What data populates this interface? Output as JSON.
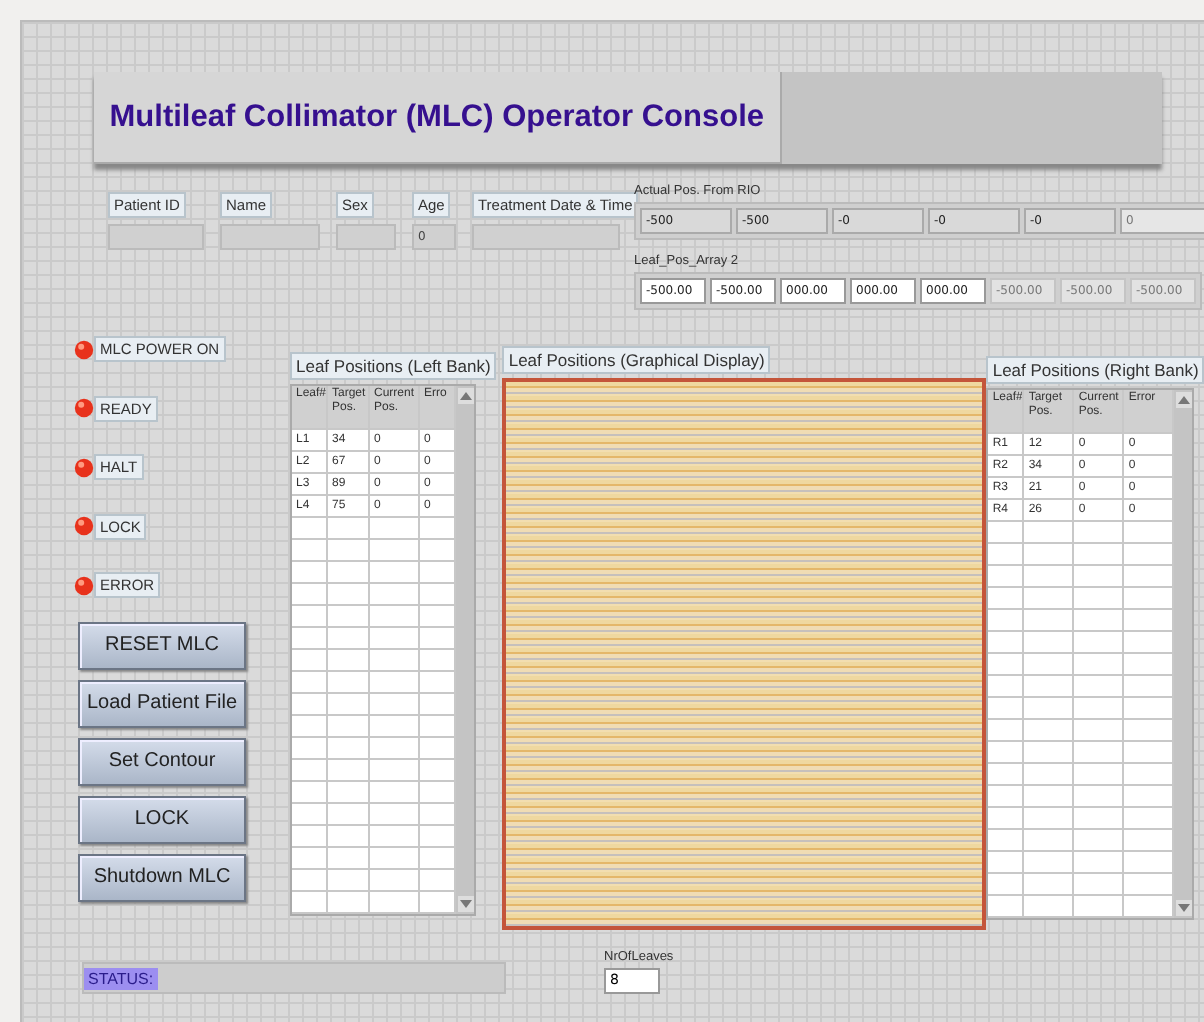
{
  "title": "Multileaf Collimator (MLC) Operator Console",
  "patient_fields": [
    {
      "label": "Patient ID"
    },
    {
      "label": "Name"
    },
    {
      "label": "Sex"
    },
    {
      "label": "Age",
      "value": "0"
    },
    {
      "label": "Treatment Date & Time"
    }
  ],
  "actual_pos": {
    "label": "Actual Pos. From RIO",
    "values": [
      {
        "value": "-500",
        "disabled": false
      },
      {
        "value": "-500",
        "disabled": false
      },
      {
        "value": "-0",
        "disabled": false
      },
      {
        "value": "-0",
        "disabled": false
      },
      {
        "value": "-0",
        "disabled": false
      },
      {
        "value": "0",
        "disabled": true
      }
    ]
  },
  "leaf_pos_array": {
    "label": "Leaf_Pos_Array 2",
    "values": [
      {
        "value": "-500.00",
        "disabled": false
      },
      {
        "value": "-500.00",
        "disabled": false
      },
      {
        "value": "000.00",
        "disabled": false
      },
      {
        "value": "000.00",
        "disabled": false
      },
      {
        "value": "000.00",
        "disabled": false
      },
      {
        "value": "-500.00",
        "disabled": true
      },
      {
        "value": "-500.00",
        "disabled": true
      },
      {
        "value": "-500.00",
        "disabled": true
      }
    ]
  },
  "indicators": [
    {
      "label": "MLC POWER ON",
      "on": true
    },
    {
      "label": "READY",
      "on": true
    },
    {
      "label": "HALT",
      "on": true
    },
    {
      "label": "LOCK",
      "on": true
    },
    {
      "label": "ERROR",
      "on": true
    }
  ],
  "buttons": [
    "RESET MLC",
    "Load Patient File",
    "Set Contour",
    "LOCK",
    "Shutdown MLC"
  ],
  "left_table": {
    "title": "Leaf Positions (Left Bank)",
    "columns": [
      "Leaf#",
      "Target Pos.",
      "Current Pos.",
      "Erro"
    ],
    "rows": [
      [
        "L1",
        "34",
        "0",
        "0"
      ],
      [
        "L2",
        "67",
        "0",
        "0"
      ],
      [
        "L3",
        "89",
        "0",
        "0"
      ],
      [
        "L4",
        "75",
        "0",
        "0"
      ]
    ]
  },
  "graph": {
    "title": "Leaf Positions (Graphical Display)"
  },
  "right_table": {
    "title": "Leaf Positions (Right Bank)",
    "columns": [
      "Leaf#",
      "Target Pos.",
      "Current Pos.",
      "Error"
    ],
    "rows": [
      [
        "R1",
        "12",
        "0",
        "0"
      ],
      [
        "R2",
        "34",
        "0",
        "0"
      ],
      [
        "R3",
        "21",
        "0",
        "0"
      ],
      [
        "R4",
        "26",
        "0",
        "0"
      ]
    ]
  },
  "status": {
    "label": "STATUS:"
  },
  "leaf_count": {
    "label": "NrOfLeaves",
    "value": "8"
  }
}
